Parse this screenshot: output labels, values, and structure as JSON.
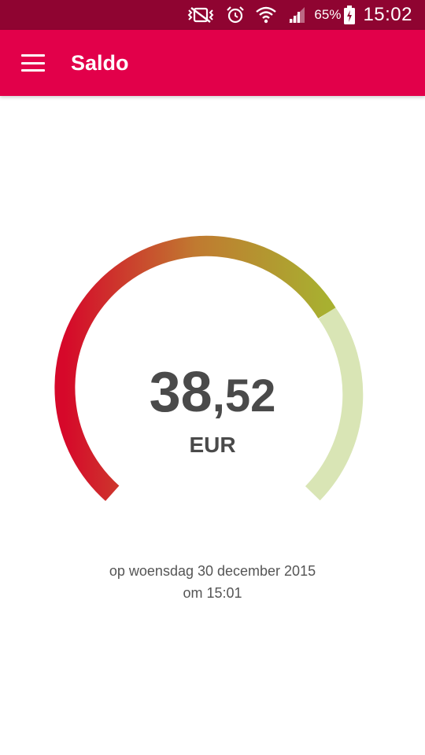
{
  "status_bar": {
    "battery_percent": "65%",
    "time": "15:02",
    "icons": [
      "vibrate-mute-icon",
      "alarm-icon",
      "wifi-icon",
      "signal-icon",
      "battery-charging-icon"
    ]
  },
  "app_bar": {
    "title": "Saldo",
    "menu_icon": "hamburger-menu-icon",
    "color": "#e2004a"
  },
  "balance": {
    "integer": "38",
    "separator": ",",
    "decimal": "52",
    "currency": "EUR",
    "gauge_level": 0.68
  },
  "timestamp": {
    "line1": "op woensdag 30 december 2015",
    "line2": "om 15:01"
  }
}
